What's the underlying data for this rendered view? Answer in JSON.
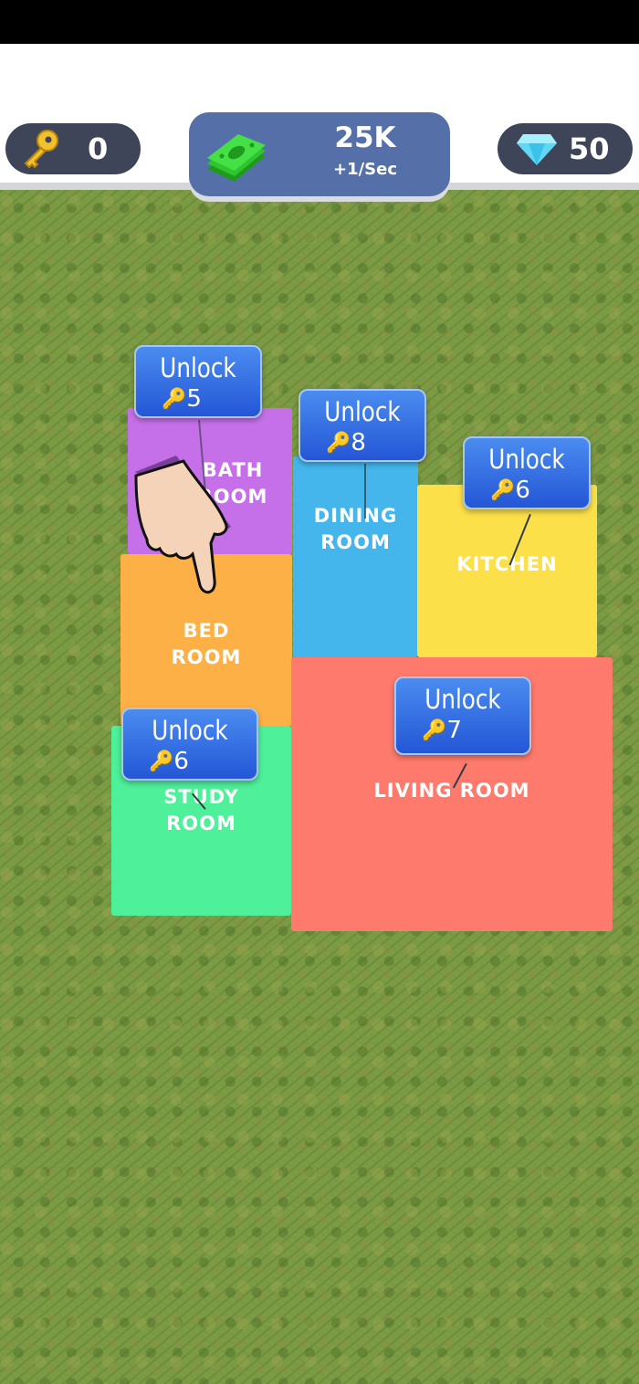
{
  "hud": {
    "keys": {
      "icon": "key-icon",
      "value": "0"
    },
    "money": {
      "icon": "cash-stack-icon",
      "amount": "25K",
      "rate": "+1/Sec"
    },
    "gems": {
      "icon": "diamond-icon",
      "value": "50"
    }
  },
  "rooms": [
    {
      "id": "bath",
      "label": "BATH\nROOM",
      "color": "#c570e8",
      "unlock_label": "Unlock",
      "cost": "5",
      "cost_icon": "key-icon"
    },
    {
      "id": "dining",
      "label": "DINING\nROOM",
      "color": "#45b6ec",
      "unlock_label": "Unlock",
      "cost": "8",
      "cost_icon": "key-icon"
    },
    {
      "id": "kitchen",
      "label": "KITCHEN",
      "color": "#fbe04a",
      "unlock_label": "Unlock",
      "cost": "6",
      "cost_icon": "key-icon"
    },
    {
      "id": "bed",
      "label": "BED\nROOM",
      "color": "#fdb045",
      "unlock_label": null,
      "cost": null
    },
    {
      "id": "study",
      "label": "STUDY\nROOM",
      "color": "#4ef09a",
      "unlock_label": "Unlock",
      "cost": "6",
      "cost_icon": "key-icon"
    },
    {
      "id": "living",
      "label": "LIVING ROOM",
      "color": "#fd7a6c",
      "unlock_label": "Unlock",
      "cost": "7",
      "cost_icon": "key-icon"
    }
  ],
  "tutorial": {
    "icon": "pointing-hand-icon"
  },
  "colors": {
    "hud_pill": "#3e4558",
    "money_panel": "#5570a8",
    "unlock_button": "#2f6ae0"
  }
}
